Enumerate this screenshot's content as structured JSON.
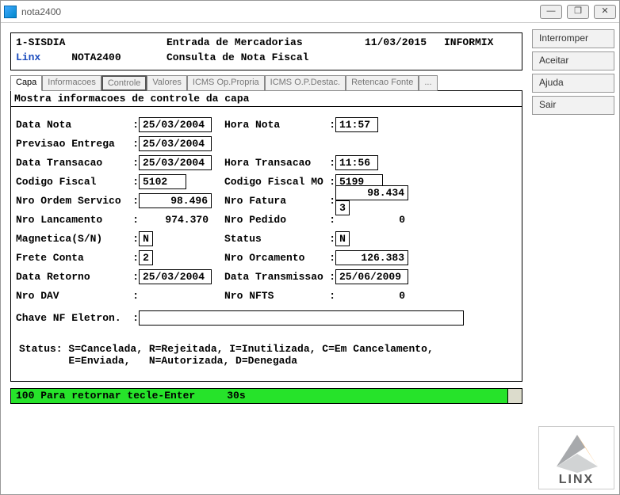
{
  "window": {
    "title": "nota2400"
  },
  "winbuttons": {
    "min": "—",
    "max": "❐",
    "close": "✕"
  },
  "sidebar": {
    "interromper": "Interromper",
    "aceitar": "Aceitar",
    "ajuda": "Ajuda",
    "sair": "Sair"
  },
  "header": {
    "line1": {
      "sys": "1-SISDIA",
      "title": "Entrada de Mercadorias",
      "date": "11/03/2015",
      "db": "INFORMIX"
    },
    "line2": {
      "vendor": "Linx",
      "prog": "NOTA2400",
      "subtitle": "Consulta de Nota Fiscal"
    }
  },
  "tabs": {
    "capa": "Capa",
    "informacoes": "Informacoes",
    "controle": "Controle",
    "valores": "Valores",
    "icms_propria": "ICMS Op.Propria",
    "icms_destac": "ICMS O.P.Destac.",
    "retencao": "Retencao Fonte",
    "more": "..."
  },
  "pane": {
    "title": "Mostra informacoes de controle da capa",
    "fields": {
      "data_nota_l": "Data Nota",
      "data_nota_v": "25/03/2004",
      "hora_nota_l": "Hora Nota",
      "hora_nota_v": "11:57",
      "prev_entrega_l": "Previsao Entrega",
      "prev_entrega_v": "25/03/2004",
      "data_trans_l": "Data Transacao",
      "data_trans_v": "25/03/2004",
      "hora_trans_l": "Hora Transacao",
      "hora_trans_v": "11:56",
      "cod_fiscal_l": "Codigo Fiscal",
      "cod_fiscal_v": "5102",
      "cod_fiscal_mo_l": "Codigo Fiscal MO",
      "cod_fiscal_mo_v": "5199",
      "nro_os_l": "Nro Ordem Servico",
      "nro_os_v": "98.496",
      "nro_fatura_l": "Nro Fatura",
      "nro_fatura_v": "98.434",
      "nro_fatura_ext": "3",
      "nro_lanc_l": "Nro Lancamento",
      "nro_lanc_v": "974.370",
      "nro_pedido_l": "Nro Pedido",
      "nro_pedido_v": "0",
      "magnetica_l": "Magnetica(S/N)",
      "magnetica_v": "N",
      "status_l": "Status",
      "status_v": "N",
      "frete_l": "Frete Conta",
      "frete_v": "2",
      "nro_orc_l": "Nro Orcamento",
      "nro_orc_v": "126.383",
      "data_ret_l": "Data Retorno",
      "data_ret_v": "25/03/2004",
      "data_transm_l": "Data Transmissao",
      "data_transm_v": "25/06/2009",
      "nro_dav_l": "Nro DAV",
      "nro_dav_v": "",
      "nro_nfts_l": "Nro NFTS",
      "nro_nfts_v": "0",
      "chave_l": "Chave NF Eletron.",
      "chave_v": ""
    },
    "legend1": "Status: S=Cancelada, R=Rejeitada,  I=Inutilizada, C=Em Cancelamento,",
    "legend2": "        E=Enviada,   N=Autorizada, D=Denegada"
  },
  "status": {
    "msg": "100 Para retornar tecle-Enter",
    "timer": "30s"
  },
  "logo": {
    "text": "LINX"
  }
}
